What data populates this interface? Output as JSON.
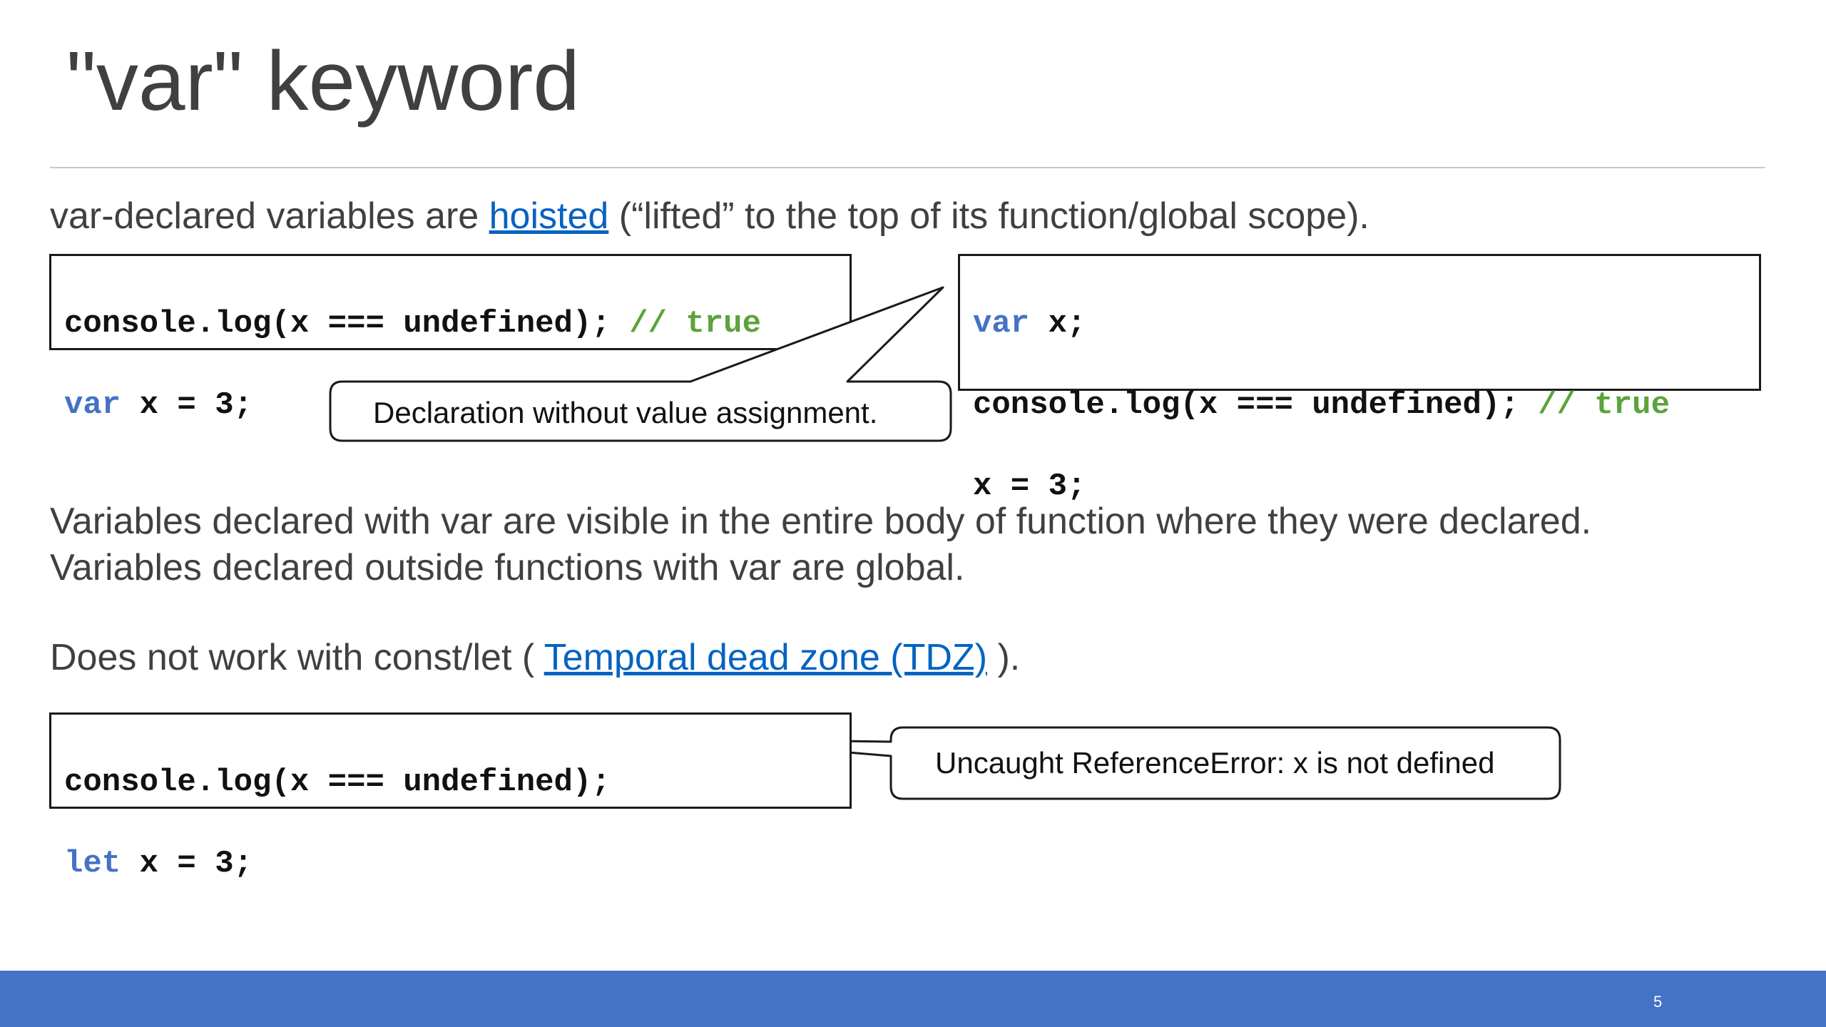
{
  "slide": {
    "title": "\"var\" keyword",
    "intro": {
      "before": "var-declared variables are ",
      "link": "hoisted",
      "after": " (“lifted” to the top of its function/global scope)."
    },
    "code1": {
      "line1_code": "console.log(x === undefined);",
      "line1_comment": "// true",
      "line2_kw": "var",
      "line2_rest": " x = 3;"
    },
    "code2": {
      "line1_kw": "var",
      "line1_rest": " x;",
      "line2_code": "console.log(x === undefined);",
      "line2_comment": "// true",
      "line3": "x = 3;"
    },
    "callout1": "Declaration without value assignment.",
    "para2_line1": "Variables declared with var are visible in the entire body of function where they were declared.",
    "para2_line2": "Variables declared outside functions with var are global.",
    "tdz": {
      "before": "Does not work with const/let ( ",
      "link": "Temporal dead zone (TDZ)",
      "after": " )."
    },
    "code3": {
      "line1_code": "console.log(x === undefined);",
      "line2_kw": "let",
      "line2_rest": " x = 3;"
    },
    "callout2": "Uncaught ReferenceError: x is not defined",
    "page_number": "5"
  },
  "colors": {
    "keyword": "#4472c4",
    "comment": "#5ba33b",
    "link": "#0563c1",
    "footer": "#4472c4"
  }
}
